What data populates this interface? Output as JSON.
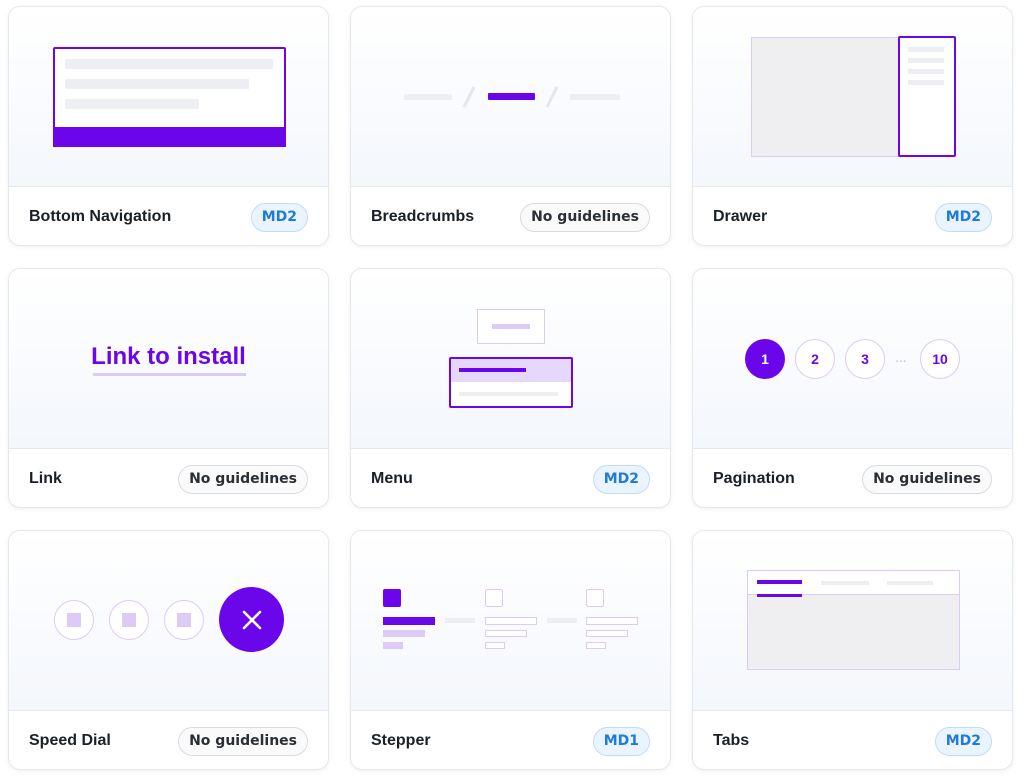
{
  "cards": [
    {
      "title": "Bottom Navigation",
      "badge": "MD2"
    },
    {
      "title": "Breadcrumbs",
      "badge": "No guidelines"
    },
    {
      "title": "Drawer",
      "badge": "MD2"
    },
    {
      "title": "Link",
      "badge": "No guidelines",
      "preview_text": "Link to install"
    },
    {
      "title": "Menu",
      "badge": "MD2"
    },
    {
      "title": "Pagination",
      "badge": "No guidelines",
      "pages": [
        "1",
        "2",
        "3",
        "...",
        "10"
      ]
    },
    {
      "title": "Speed Dial",
      "badge": "No guidelines"
    },
    {
      "title": "Stepper",
      "badge": "MD1"
    },
    {
      "title": "Tabs",
      "badge": "MD2"
    }
  ],
  "colors": {
    "accent": "#6b05ea",
    "accent_light": "#dccbf7",
    "badge_md_text": "#1f7ad8",
    "badge_md_bg": "#eaf4ff"
  },
  "icons": {
    "speed_dial": "close-icon"
  }
}
